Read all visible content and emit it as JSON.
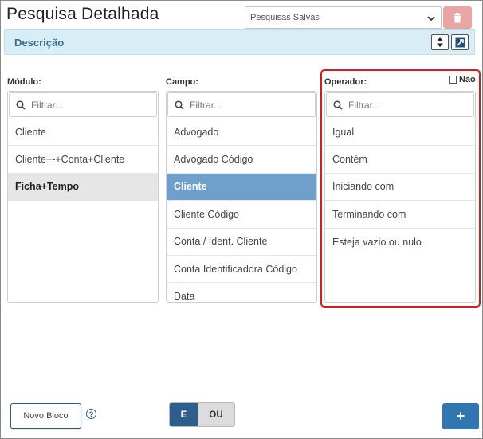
{
  "header": {
    "title": "Pesquisa Detalhada",
    "saved_searches": {
      "selected": "Pesquisas Salvas"
    },
    "delete_icon": "trash-icon"
  },
  "description_bar": {
    "label": "Descrição",
    "icons": [
      "sort-icon",
      "expand-icon"
    ]
  },
  "columns": {
    "modulo": {
      "label": "Módulo:",
      "filter_placeholder": "Filtrar...",
      "items": [
        "Cliente",
        "Cliente+-+Conta+Cliente",
        "Ficha+Tempo"
      ],
      "selected_index": 2
    },
    "campo": {
      "label": "Campo:",
      "filter_placeholder": "Filtrar...",
      "items": [
        "Advogado",
        "Advogado Código",
        "Cliente",
        "Cliente Código",
        "Conta / Ident. Cliente",
        "Conta Identificadora Código",
        "Data"
      ],
      "selected_index": 2
    },
    "operador": {
      "label": "Operador:",
      "filter_placeholder": "Filtrar...",
      "negate_label": "Não",
      "items": [
        "Igual",
        "Contém",
        "Iniciando com",
        "Terminando com",
        "Esteja vazio ou nulo"
      ]
    }
  },
  "footer": {
    "new_block_label": "Novo Bloco",
    "help_label": "?",
    "logic": {
      "and_label": "E",
      "or_label": "OU",
      "active": "E"
    },
    "add_label": "+"
  },
  "colors": {
    "selected_blue": "#6f9fcb",
    "selected_grey": "#e6e6e6",
    "highlight_red": "#e01818",
    "primary_button": "#3276b1",
    "desc_bar": "#d9edf7"
  }
}
